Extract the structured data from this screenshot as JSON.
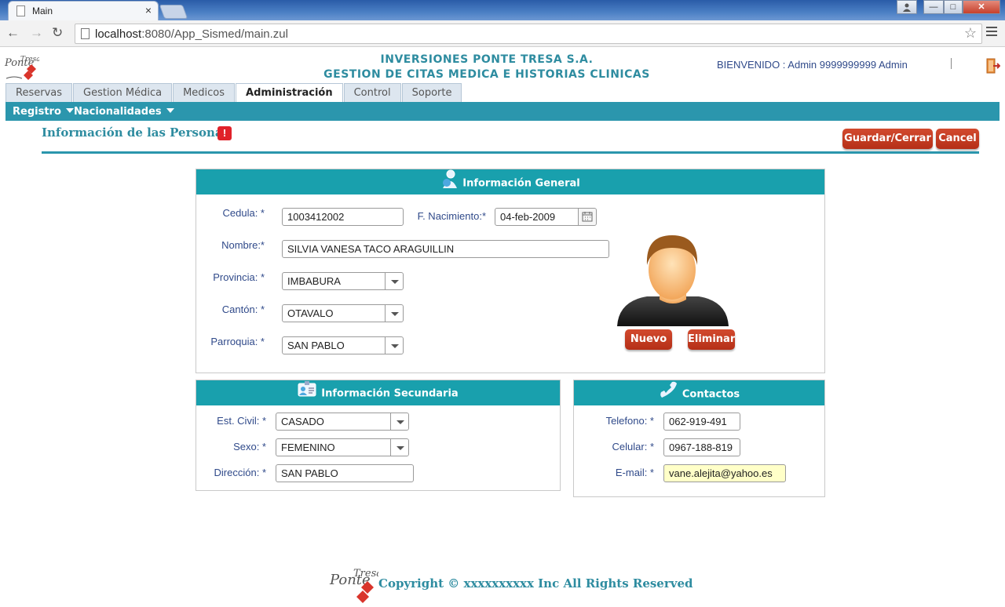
{
  "browser": {
    "tab_title": "Main",
    "tab_close": "×",
    "url_host": "localhost",
    "url_rest": ":8080/App_Sismed/main.zul",
    "back": "←",
    "forward": "→",
    "reload": "↻",
    "star": "☆",
    "window_controls": [
      "—",
      "□",
      "✕"
    ]
  },
  "header": {
    "company_line1": "INVERSIONES PONTE TRESA S.A.",
    "company_line2": "GESTION DE CITAS MEDICA E HISTORIAS CLINICAS",
    "welcome": "BIENVENIDO : Admin 9999999999 Admin"
  },
  "main_tabs": [
    {
      "label": "Reservas",
      "active": false
    },
    {
      "label": "Gestion Médica",
      "active": false
    },
    {
      "label": "Medicos",
      "active": false
    },
    {
      "label": "Administración",
      "active": true
    },
    {
      "label": "Control",
      "active": false
    },
    {
      "label": "Soporte",
      "active": false
    }
  ],
  "submenu": {
    "registro": "Registro",
    "nacionalidades": "Nacionalidades"
  },
  "page": {
    "title": "Información de las Persona",
    "warn": "!",
    "save_label": "Guardar/Cerrar",
    "cancel_label": "Cancel"
  },
  "general": {
    "heading": "Información General",
    "cedula_label": "Cedula: *",
    "cedula": "1003412002",
    "nacimiento_label": "F. Nacimiento:*",
    "nacimiento": "04-feb-2009",
    "nombre_label": "Nombre:*",
    "nombre": "SILVIA VANESA TACO ARAGUILLIN",
    "provincia_label": "Provincia: *",
    "provincia": "IMBABURA",
    "canton_label": "Cantón: *",
    "canton": "OTAVALO",
    "parroquia_label": "Parroquia: *",
    "parroquia": "SAN PABLO",
    "nuevo_label": "Nuevo",
    "eliminar_label": "Eliminar"
  },
  "secondary": {
    "heading": "Información Secundaria",
    "civil_label": "Est. Civil: *",
    "civil": "CASADO",
    "sexo_label": "Sexo: *",
    "sexo": "FEMENINO",
    "direccion_label": "Dirección: *",
    "direccion": "SAN PABLO"
  },
  "contacts": {
    "heading": "Contactos",
    "telefono_label": "Telefono: *",
    "telefono": "062-919-491",
    "celular_label": "Celular: *",
    "celular": "0967-188-819",
    "email_label": "E-mail: *",
    "email": "vane.alejita@yahoo.es"
  },
  "footer": {
    "copyright": "Copyright © xxxxxxxxxx Inc All Rights Reserved"
  }
}
